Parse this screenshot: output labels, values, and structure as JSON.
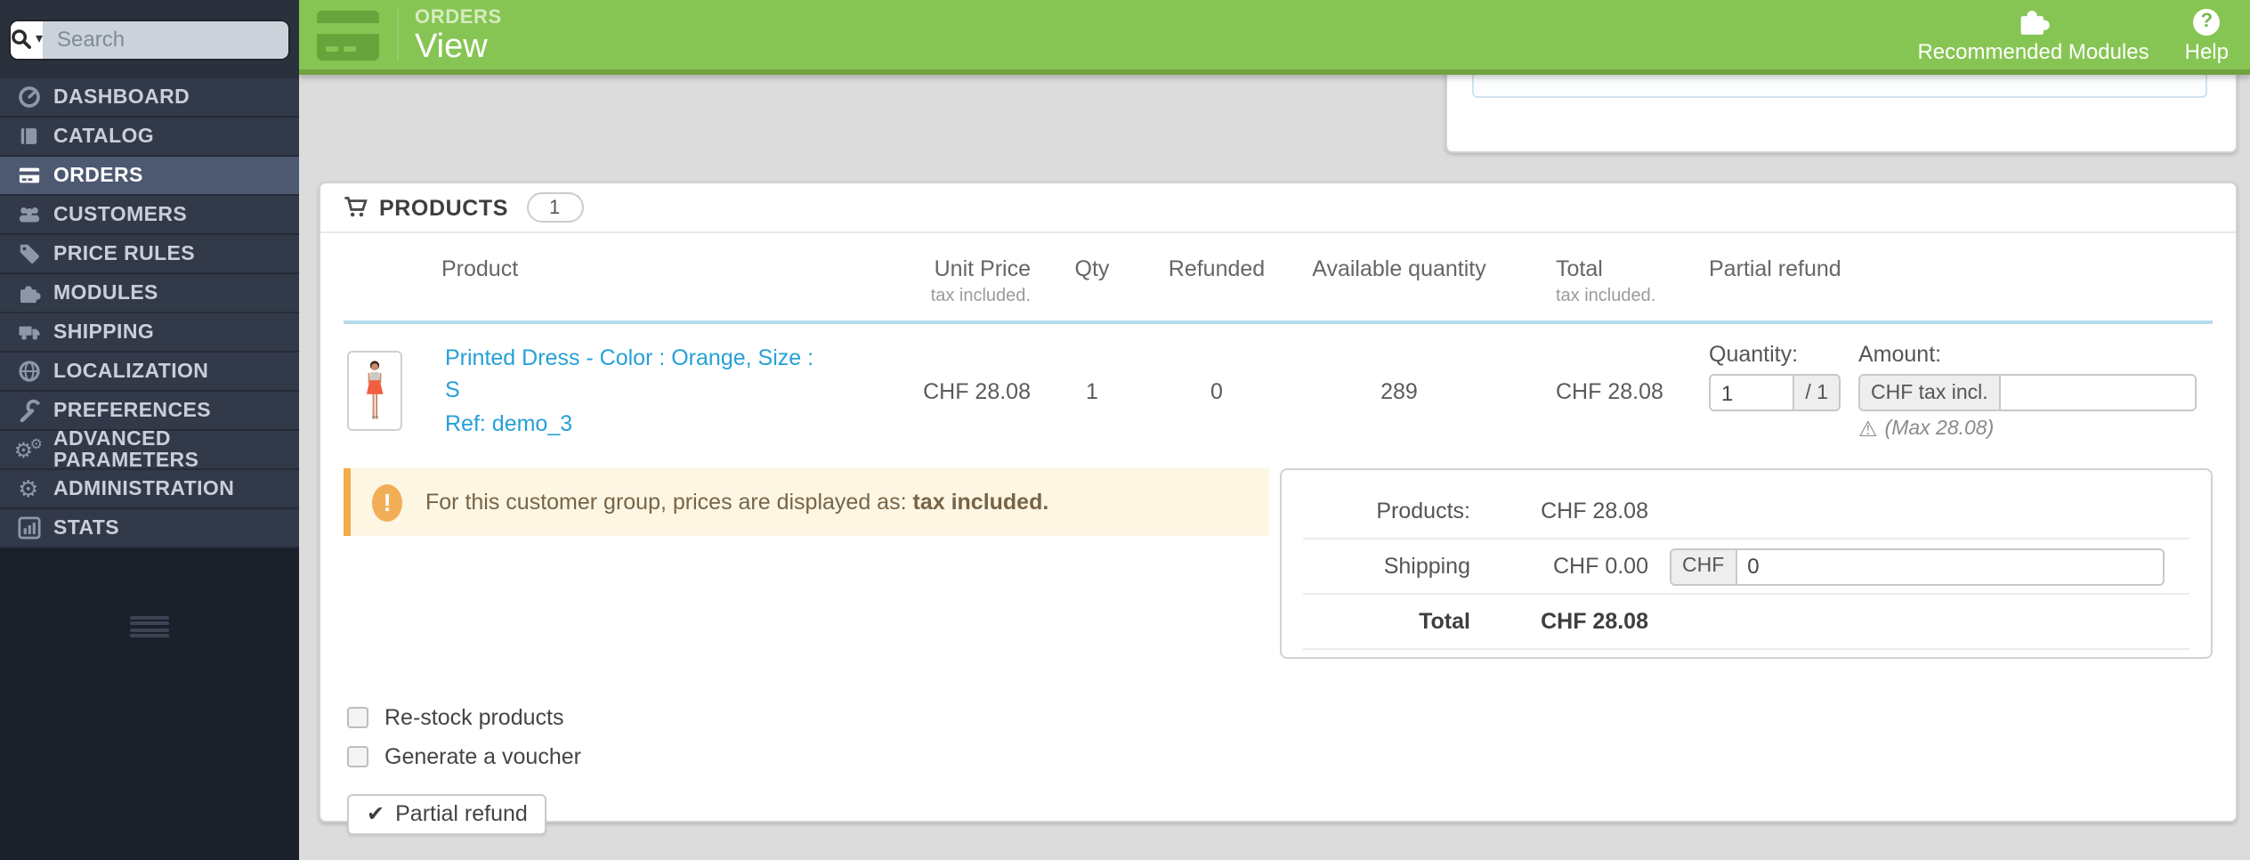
{
  "sidebar": {
    "search_placeholder": "Search",
    "items": [
      {
        "label": "DASHBOARD",
        "icon": "dashboard-icon"
      },
      {
        "label": "CATALOG",
        "icon": "catalog-icon"
      },
      {
        "label": "ORDERS",
        "icon": "orders-icon",
        "active": true
      },
      {
        "label": "CUSTOMERS",
        "icon": "customers-icon"
      },
      {
        "label": "PRICE RULES",
        "icon": "price-rules-icon"
      },
      {
        "label": "MODULES",
        "icon": "modules-icon"
      },
      {
        "label": "SHIPPING",
        "icon": "shipping-icon"
      },
      {
        "label": "LOCALIZATION",
        "icon": "localization-icon"
      },
      {
        "label": "PREFERENCES",
        "icon": "preferences-icon"
      },
      {
        "label": "ADVANCED PARAMETERS",
        "icon": "advanced-parameters-icon"
      },
      {
        "label": "ADMINISTRATION",
        "icon": "administration-icon"
      },
      {
        "label": "STATS",
        "icon": "stats-icon"
      }
    ]
  },
  "header": {
    "breadcrumb": "ORDERS",
    "title": "View",
    "accent_color": "#86c553",
    "actions": [
      {
        "label": "Recommended Modules",
        "icon": "puzzle-icon"
      },
      {
        "label": "Help",
        "icon": "question-icon"
      }
    ]
  },
  "products_panel": {
    "heading": "PRODUCTS",
    "count_badge": "1",
    "table": {
      "headers": {
        "product": "Product",
        "unit_price": "Unit Price",
        "unit_price_sub": "tax included.",
        "qty": "Qty",
        "refunded": "Refunded",
        "available_quantity": "Available quantity",
        "total": "Total",
        "total_sub": "tax included.",
        "partial_refund": "Partial refund"
      },
      "rows": [
        {
          "name": "Printed Dress - Color : Orange, Size : S",
          "ref": "Ref: demo_3",
          "unit_price": "CHF 28.08",
          "qty": "1",
          "refunded": "0",
          "available_quantity": "289",
          "total": "CHF 28.08",
          "refund_quantity_label": "Quantity:",
          "refund_quantity_value": "1",
          "refund_quantity_addon": "/ 1",
          "refund_amount_label": "Amount:",
          "refund_amount_addon": "CHF tax incl.",
          "refund_amount_value": "",
          "refund_max_note": "(Max 28.08)"
        }
      ]
    },
    "tax_notice": {
      "text": "For this customer group, prices are displayed as:",
      "bold": "tax included."
    },
    "totals": {
      "rows": [
        {
          "label": "Products:",
          "value": "CHF 28.08"
        },
        {
          "label": "Shipping",
          "value": "CHF 0.00",
          "input_addon": "CHF",
          "input_value": "0"
        },
        {
          "label": "Total",
          "value": "CHF 28.08"
        }
      ]
    },
    "options": [
      {
        "label": "Re-stock products"
      },
      {
        "label": "Generate a voucher"
      }
    ],
    "submit_button": "Partial refund"
  }
}
